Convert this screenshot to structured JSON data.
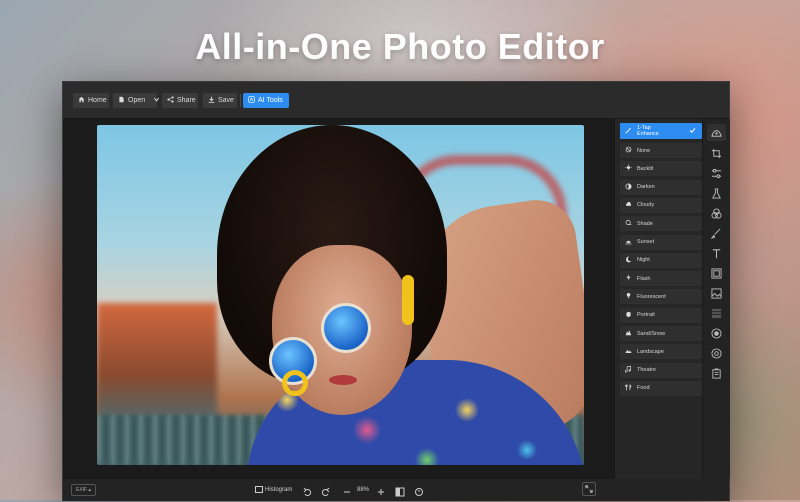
{
  "headline": "All-in-One Photo Editor",
  "toolbar": {
    "home": "Home",
    "open": "Open",
    "share": "Share",
    "save": "Save",
    "ai_tools": "AI Tools"
  },
  "presets": [
    {
      "label": "1-Tap Enhance",
      "icon": "magic-wand-icon",
      "active": true
    },
    {
      "label": "None",
      "icon": "none-icon"
    },
    {
      "label": "Backlit",
      "icon": "backlit-icon"
    },
    {
      "label": "Darken",
      "icon": "darken-icon"
    },
    {
      "label": "Cloudy",
      "icon": "cloud-icon"
    },
    {
      "label": "Shade",
      "icon": "shade-icon"
    },
    {
      "label": "Sunset",
      "icon": "sunset-icon"
    },
    {
      "label": "Night",
      "icon": "moon-icon"
    },
    {
      "label": "Flash",
      "icon": "flash-icon"
    },
    {
      "label": "Fluorescent",
      "icon": "fluorescent-icon"
    },
    {
      "label": "Portrait",
      "icon": "portrait-icon"
    },
    {
      "label": "Sand/Snow",
      "icon": "sand-snow-icon"
    },
    {
      "label": "Landscape",
      "icon": "landscape-icon"
    },
    {
      "label": "Theatre",
      "icon": "theatre-icon"
    },
    {
      "label": "Food",
      "icon": "food-icon"
    }
  ],
  "statusbar": {
    "exif": "EXIF",
    "histogram": "Histogram",
    "zoom": "88%"
  },
  "colors": {
    "accent": "#2d8cf0",
    "window_bg": "#232323",
    "panel_bg": "#262626"
  }
}
